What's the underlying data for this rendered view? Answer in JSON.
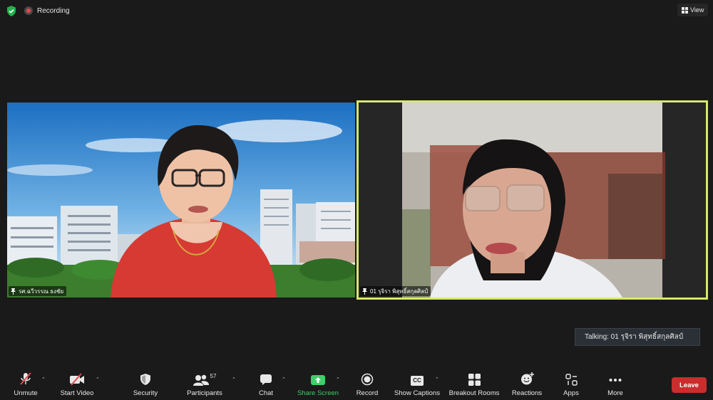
{
  "top_bar": {
    "security_icon": "shield-check-icon",
    "recording_label": "Recording",
    "view_label": "View"
  },
  "participants": [
    {
      "name": "รศ.ฉวีวรรณ  ธงชัย",
      "pinned": true
    },
    {
      "name": "01 รุจิรา พิสุทธิ์สกุลศิลป์",
      "pinned": true,
      "active_speaker": true
    }
  ],
  "talking": {
    "label": "Talking: 01 รุจิรา พิสุทธิ์สกุลศิลป์"
  },
  "toolbar": {
    "unmute_label": "Unmute",
    "start_video_label": "Start Video",
    "security_label": "Security",
    "participants_label": "Participants",
    "participants_count": "57",
    "chat_label": "Chat",
    "share_screen_label": "Share Screen",
    "record_label": "Record",
    "show_captions_label": "Show Captions",
    "captions_icon_text": "CC",
    "breakout_rooms_label": "Breakout Rooms",
    "reactions_label": "Reactions",
    "apps_label": "Apps",
    "more_label": "More",
    "leave_label": "Leave"
  },
  "colors": {
    "background": "#1a1a1a",
    "active_speaker_border": "#d7e86a",
    "leave_button": "#c92d2d",
    "share_screen": "#3ccf6a",
    "recording_dot": "#e5484d"
  }
}
